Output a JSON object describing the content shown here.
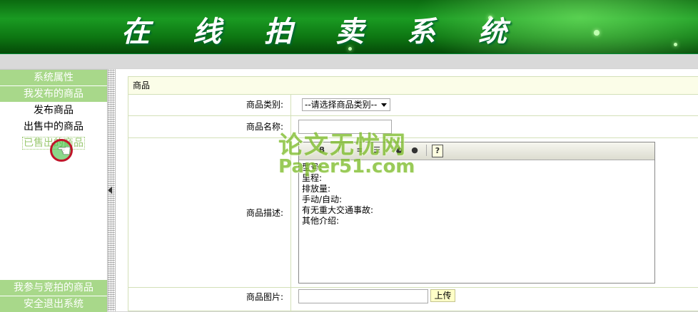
{
  "banner": {
    "title": "在线拍卖系统"
  },
  "sidebar": {
    "groups_top": [
      {
        "header": "系统属性"
      },
      {
        "header": "我发布的商品",
        "links": [
          "发布商品",
          "出售中的商品",
          "已售出的商品"
        ]
      }
    ],
    "groups_bottom": [
      "我参与竞拍的商品",
      "安全退出系统"
    ],
    "active_link": "已售出的商品"
  },
  "form": {
    "panel_title": "商品",
    "category": {
      "label": "商品类别:",
      "value": "--请选择商品类别--"
    },
    "name": {
      "label": "商品名称:",
      "value": ""
    },
    "description": {
      "label": "商品描述:",
      "toolbar_icons": [
        "bold-icon",
        "italic-icon",
        "ordered-list-icon",
        "unordered-list-icon",
        "link-icon",
        "unlink-icon",
        "help-icon"
      ],
      "lines": [
        "型号:",
        "里程:",
        "排放量:",
        "手动/自动:",
        "有无重大交通事故:",
        "其他介绍:"
      ]
    },
    "image": {
      "label": "商品图片:",
      "upload_label": "上传"
    }
  },
  "watermark": {
    "cn": "论文无忧网",
    "en": "Paper51.com"
  },
  "colors": {
    "banner_green": "#1a9a22",
    "sidebar_header": "#a8d88a",
    "panel_title_bg": "#fbfde8",
    "active_link": "#9ac870"
  }
}
